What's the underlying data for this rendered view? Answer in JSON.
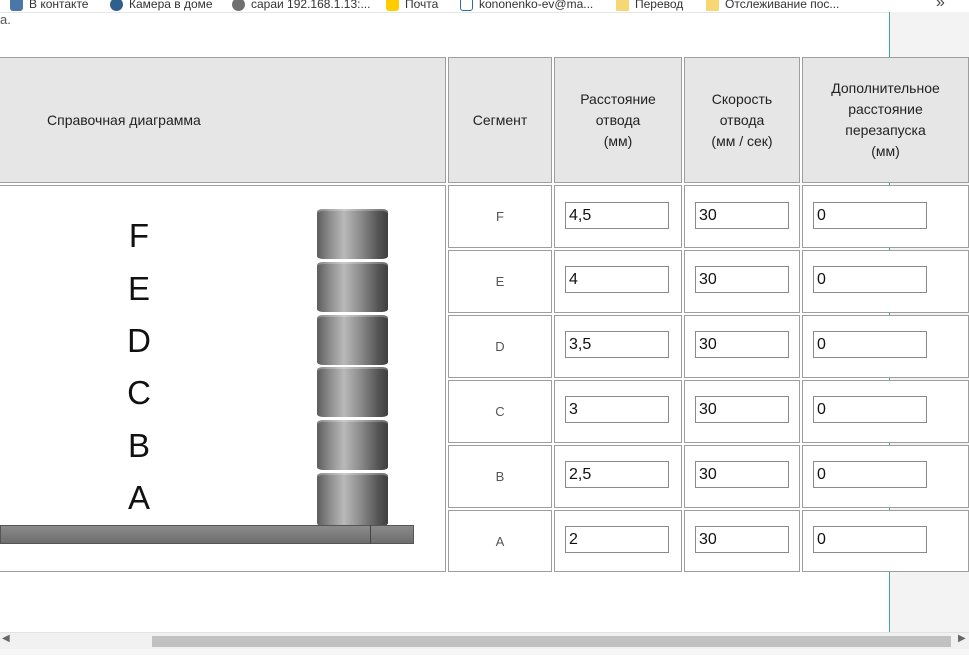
{
  "bookmarks": [
    {
      "label": "В контакте",
      "icon": "vk-icon"
    },
    {
      "label": "Камера в доме",
      "icon": "camera-icon"
    },
    {
      "label": "сараи 192.168.1.13:...",
      "icon": "globe-icon"
    },
    {
      "label": "Почта",
      "icon": "mail-icon"
    },
    {
      "label": "kononenko-ev@ma...",
      "icon": "outlook-icon"
    },
    {
      "label": "Перевод",
      "icon": "folder-icon"
    },
    {
      "label": "Отслеживание пос...",
      "icon": "folder-icon"
    }
  ],
  "bookmarks_more": "»",
  "page_fragment": "a.",
  "table": {
    "headers": {
      "diagram": "Справочная диаграмма",
      "segment": "Сегмент",
      "distance": "Расстояние\nотвода\n(мм)",
      "speed": "Скорость\nотвода\n(мм / сек)",
      "extra": "Дополнительное\nрасстояние\nперезапуска\n(мм)"
    },
    "rows": [
      {
        "segment": "F",
        "distance": "4,5",
        "speed": "30",
        "extra": "0"
      },
      {
        "segment": "E",
        "distance": "4",
        "speed": "30",
        "extra": "0"
      },
      {
        "segment": "D",
        "distance": "3,5",
        "speed": "30",
        "extra": "0"
      },
      {
        "segment": "C",
        "distance": "3",
        "speed": "30",
        "extra": "0"
      },
      {
        "segment": "B",
        "distance": "2,5",
        "speed": "30",
        "extra": "0"
      },
      {
        "segment": "A",
        "distance": "2",
        "speed": "30",
        "extra": "0"
      }
    ]
  },
  "diagram": {
    "letters": [
      "F",
      "E",
      "D",
      "C",
      "B",
      "A"
    ]
  }
}
